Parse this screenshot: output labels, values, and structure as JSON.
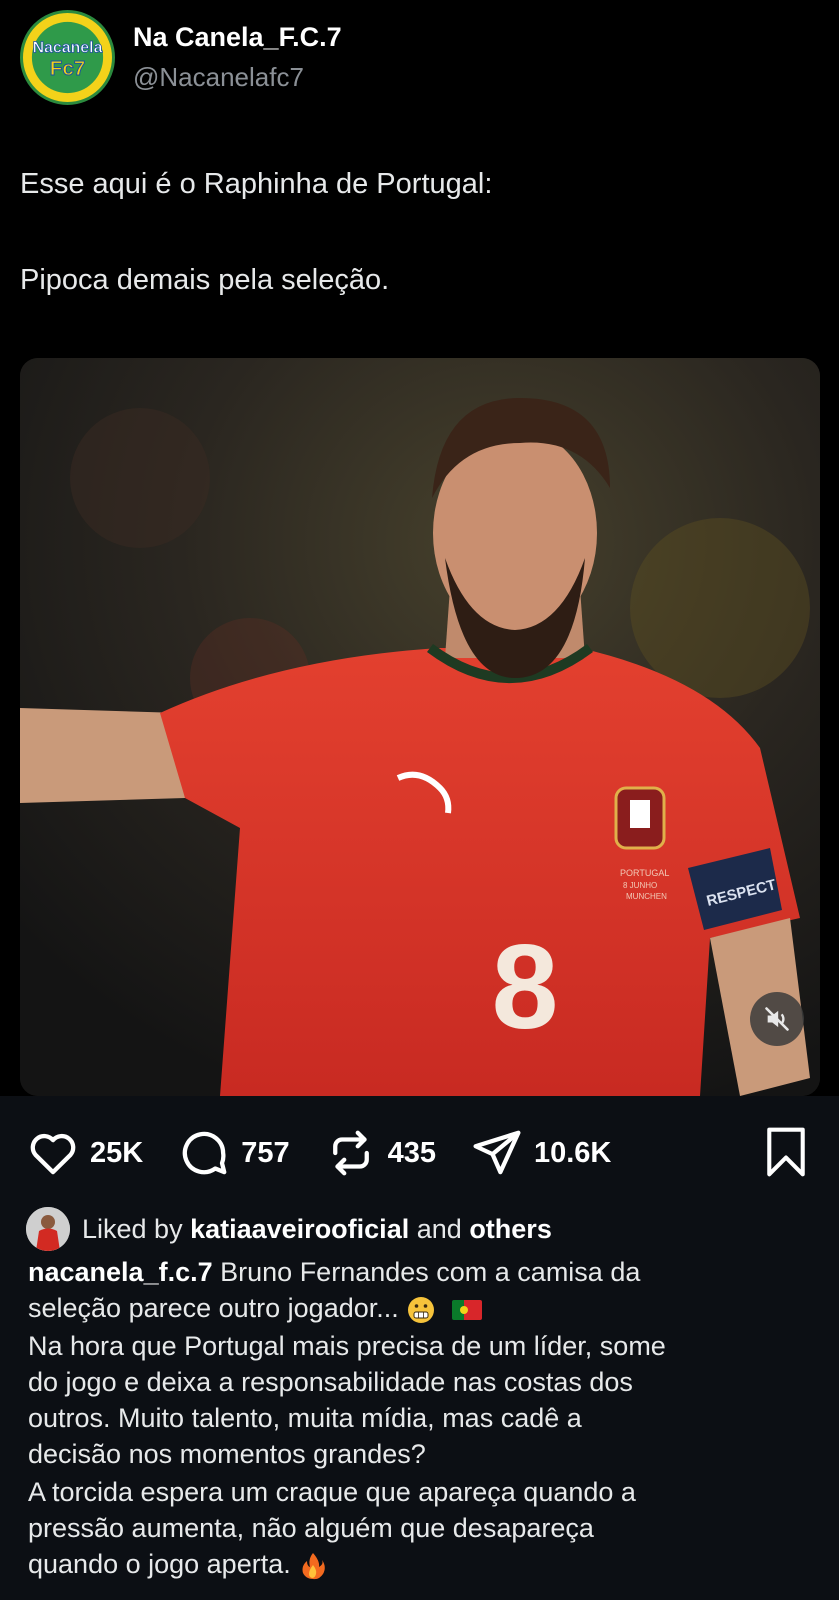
{
  "tweet": {
    "display_name": "Na Canela_F.C.7",
    "handle": "@Nacanelafc7",
    "avatar_logo_text": [
      "Nacanela",
      "Fc7"
    ],
    "text_line_1": "Esse aqui é o Raphinha de Portugal:",
    "text_line_2": "Pipoca demais pela seleção."
  },
  "media": {
    "jersey_number": "8",
    "armband_text": "RESPECT",
    "jersey_print": [
      "PORTUGAL",
      "8 JUNHO",
      "MUNCHEN"
    ],
    "mute_icon": "speaker-muted-icon"
  },
  "post": {
    "actions": [
      {
        "icon": "heart-icon",
        "count": "25K"
      },
      {
        "icon": "comment-icon",
        "count": "757"
      },
      {
        "icon": "repost-icon",
        "count": "435"
      },
      {
        "icon": "share-icon",
        "count": "10.6K"
      }
    ],
    "bookmark_icon": "bookmark-icon",
    "liked_by_prefix": "Liked by",
    "liked_by_user": "katiaaveirooficial",
    "liked_by_and": "and",
    "liked_by_others": "others",
    "caption_user": "nacanela_f.c.7",
    "caption_line_1": "Bruno Fernandes com a camisa da",
    "caption_line_2": "seleção parece outro jogador...",
    "caption_para_2": [
      "Na hora que Portugal mais precisa de um líder, some",
      "do jogo e deixa a responsabilidade nas costas dos",
      "outros. Muito talento, muita mídia, mas cadê a",
      "decisão nos momentos grandes?"
    ],
    "caption_para_3": [
      "A torcida espera um craque que apareça quando a",
      "pressão aumenta, não alguém que desapareça",
      "quando o jogo aperta."
    ],
    "emojis": [
      "grimacing-face",
      "portugal-flag",
      "fire"
    ]
  },
  "colors": {
    "background": "#000000",
    "panel": "#0c0f14",
    "muted_text": "#8b9096",
    "jersey_red": "#d9332b"
  }
}
